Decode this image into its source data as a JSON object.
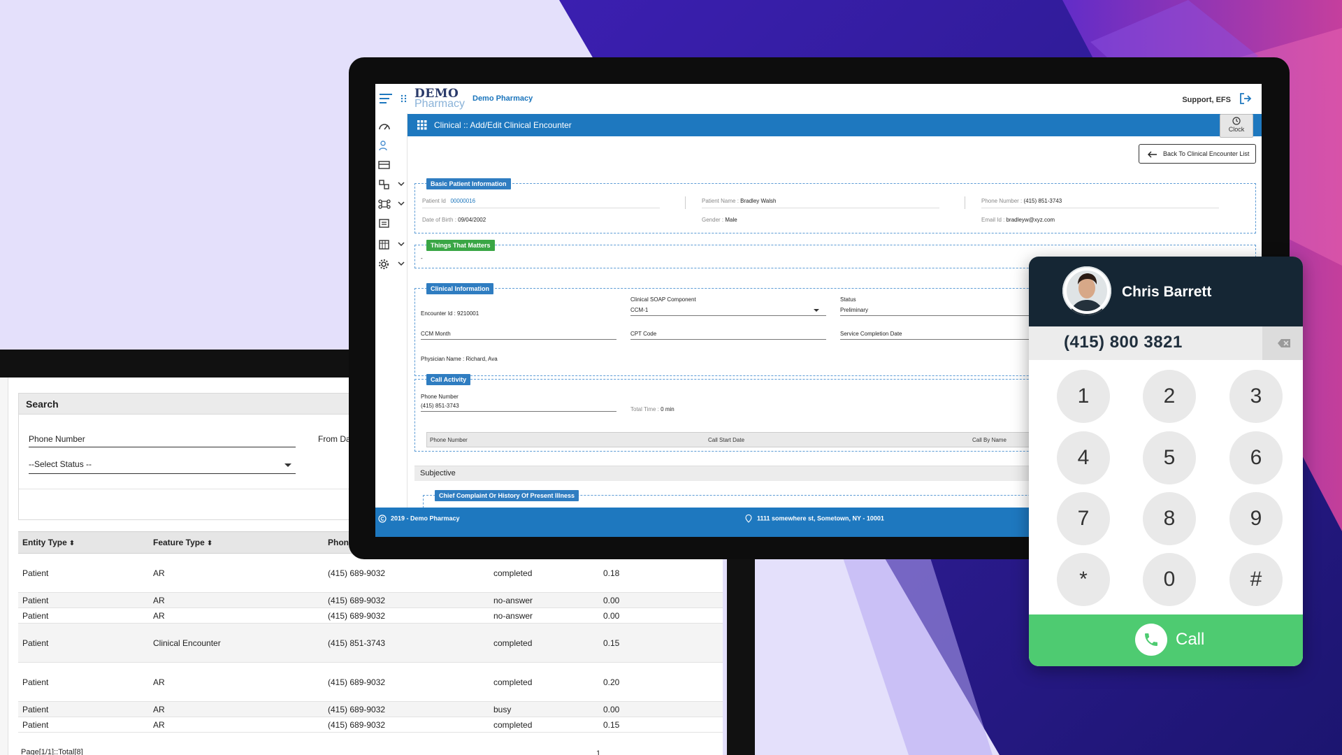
{
  "colors": {
    "accent_blue": "#1e78bf",
    "legend_blue": "#2f7dc1",
    "legend_green": "#3aa645",
    "call_green": "#4ecb71",
    "dialer_header": "#152634"
  },
  "search": {
    "title": "Search",
    "phone_label": "Phone Number",
    "from_label": "From Da",
    "status_placeholder": "--Select Status --"
  },
  "table": {
    "headers": [
      "Entity Type",
      "Feature Type",
      "Phone",
      "",
      ""
    ],
    "rows": [
      [
        "Patient",
        "AR",
        "(415) 689-9032",
        "completed",
        "0.18"
      ],
      [
        "Patient",
        "AR",
        "(415) 689-9032",
        "no-answer",
        "0.00"
      ],
      [
        "Patient",
        "AR",
        "(415) 689-9032",
        "no-answer",
        "0.00"
      ],
      [
        "Patient",
        "Clinical Encounter",
        "(415) 851-3743",
        "completed",
        "0.15"
      ],
      [
        "Patient",
        "AR",
        "(415) 689-9032",
        "completed",
        "0.20"
      ],
      [
        "Patient",
        "AR",
        "(415) 689-9032",
        "busy",
        "0.00"
      ],
      [
        "Patient",
        "AR",
        "(415) 689-9032",
        "completed",
        "0.15"
      ]
    ],
    "pager": "Page[1/1]::Total[8]",
    "page_number": "1"
  },
  "app": {
    "logo_line1": "DEMO",
    "logo_line2": "Pharmacy",
    "brand": "Demo Pharmacy",
    "user": "Support, EFS",
    "breadcrumb": "Clinical :: Add/Edit Clinical Encounter",
    "clock_label": "Clock",
    "back_button": "Back To Clinical Encounter List"
  },
  "basic_info": {
    "title": "Basic Patient Information",
    "patient_id_label": "Patient Id",
    "patient_id": "00000016",
    "patient_name_label": "Patient Name :",
    "patient_name": "Bradley Walsh",
    "phone_label": "Phone Number",
    "phone": "(415) 851-3743",
    "dob_label": "Date of Birth :",
    "dob": "09/04/2002",
    "gender_label": "Gender :",
    "gender": "Male",
    "email_label": "Email Id :",
    "email": "bradleyw@xyz.com"
  },
  "things": {
    "title": "Things That Matters",
    "value": "-"
  },
  "clinical": {
    "title": "Clinical Information",
    "encounter_id": "Encounter Id : 9210001",
    "soap_label": "Clinical SOAP Component",
    "soap_value": "CCM-1",
    "status_label": "Status",
    "status_value": "Preliminary",
    "ccm_month": "CCM Month",
    "cpt_code": "CPT Code",
    "service_date": "Service Completion Date",
    "physician": "Physician Name : Richard, Ava"
  },
  "call_activity": {
    "title": "Call Activity",
    "phone_label": "Phone Number",
    "phone_value": "(415) 851-3743",
    "total_time_label": "Total Time :",
    "total_time": "0 min",
    "col_phone": "Phone Number",
    "col_start": "Call Start Date",
    "col_by": "Call By Name"
  },
  "subjective": {
    "title": "Subjective",
    "chief_complaint": "Chief Complaint Or History Of Present Illness"
  },
  "footer": {
    "copyright": "2019 - Demo Pharmacy",
    "address": "1111 somewhere st, Sometown, NY - 10001"
  },
  "dialer": {
    "caller_name": "Chris Barrett",
    "number": "(415) 800 3821",
    "keys": [
      "1",
      "2",
      "3",
      "4",
      "5",
      "6",
      "7",
      "8",
      "9",
      "*",
      "0",
      "#"
    ],
    "call_label": "Call"
  }
}
